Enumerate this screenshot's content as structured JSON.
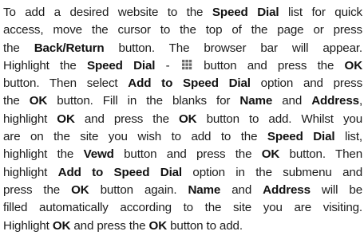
{
  "paragraph": {
    "t1": "To add a desired website to the ",
    "b_speed_dial_1": "Speed Dial",
    "t2": " list for quick access, move the cursor to the top of the page or press the ",
    "b_back_return": "Back/Return",
    "t3": " button. The browser bar will appear. Highlight the ",
    "b_speed_dial_2": "Speed Dial",
    "t4": " - ",
    "t5": " button and press the ",
    "b_ok_1": "OK",
    "t6": " button. Then select ",
    "b_add_to_speed_dial_1": "Add to Speed Dial",
    "t7": " option and press the ",
    "b_ok_2": "OK",
    "t8": " button. Fill in the blanks for ",
    "b_name_1": "Name",
    "t9": " and ",
    "b_address_1": "Address",
    "t10": ", highlight ",
    "b_ok_3": "OK",
    "t11": " and press the ",
    "b_ok_4": "OK",
    "t12": " button to add. Whilst you are on the site you wish to add to the ",
    "b_speed_dial_3": "Speed Dial",
    "t13": " list, highlight the ",
    "b_vewd": "Vewd",
    "t14": " button and press the ",
    "b_ok_5": "OK",
    "t15": " button. Then highlight ",
    "b_add_to_speed_dial_2": "Add to Speed Dial",
    "t16": " option in the submenu and press the ",
    "b_ok_6": "OK",
    "t17": " button again. ",
    "b_name_2": "Name",
    "t18": " and ",
    "b_address_2": "Address",
    "t19": " will be filled automatically according to the site you are visiting. Highlight ",
    "b_ok_7": "OK",
    "t20": " and press the ",
    "b_ok_8": "OK",
    "t21": " button to add."
  },
  "icons": {
    "speed_dial": "speed-dial-grid-icon",
    "speed_dial_color": "#6b6b6b"
  }
}
